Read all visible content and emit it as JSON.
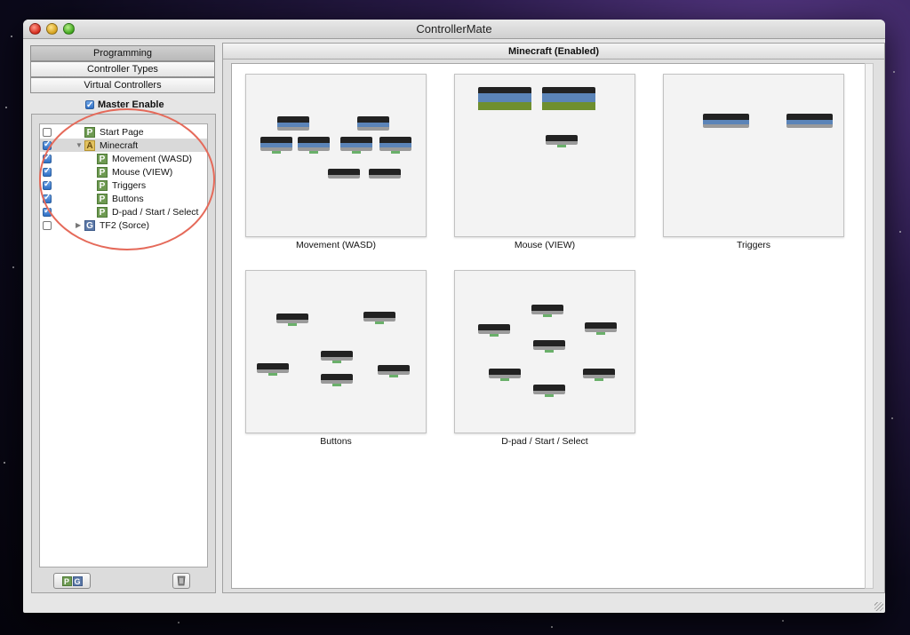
{
  "window": {
    "title": "ControllerMate"
  },
  "segments": [
    "Programming",
    "Controller Types",
    "Virtual Controllers"
  ],
  "master_enable": {
    "label": "Master Enable",
    "checked": true
  },
  "tree": [
    {
      "label": "Start Page",
      "badge": "P",
      "checked": false,
      "indent": 0
    },
    {
      "label": "Minecraft",
      "badge": "A",
      "checked": true,
      "indent": 0,
      "expanded": true,
      "selected": true
    },
    {
      "label": "Movement (WASD)",
      "badge": "P",
      "checked": true,
      "indent": 1
    },
    {
      "label": "Mouse (VIEW)",
      "badge": "P",
      "checked": true,
      "indent": 1
    },
    {
      "label": "Triggers",
      "badge": "P",
      "checked": true,
      "indent": 1
    },
    {
      "label": "Buttons",
      "badge": "P",
      "checked": true,
      "indent": 1
    },
    {
      "label": "D-pad / Start / Select",
      "badge": "P",
      "checked": true,
      "indent": 1
    },
    {
      "label": "TF2 (Sorce)",
      "badge": "G",
      "checked": false,
      "indent": 0,
      "expanded": false
    }
  ],
  "bottom_buttons": {
    "add_badges": [
      "P",
      "G"
    ],
    "trash": "trash-icon"
  },
  "panel": {
    "title": "Minecraft (Enabled)"
  },
  "thumbnails": [
    {
      "label": "Movement (WASD)"
    },
    {
      "label": "Mouse (VIEW)"
    },
    {
      "label": "Triggers"
    },
    {
      "label": "Buttons"
    },
    {
      "label": "D-pad / Start / Select"
    }
  ],
  "colors": {
    "highlight_circle": "#e56a5a",
    "page_badge": "#6e9a52",
    "group_badge": "#5c79a8",
    "app_badge": "#e2c260"
  }
}
